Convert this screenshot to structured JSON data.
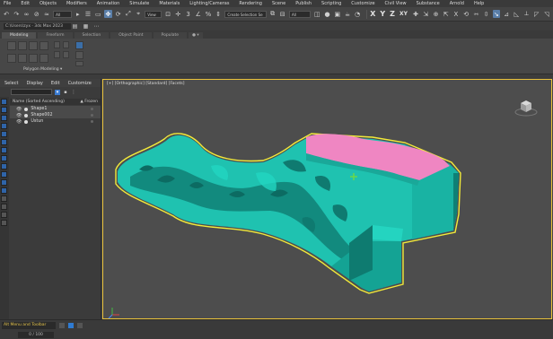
{
  "menubar": [
    "File",
    "Edit",
    "Objects",
    "Modifiers",
    "Animation",
    "Simulate",
    "Materials",
    "Lighting/Cameras",
    "Rendering",
    "Scene",
    "Publish",
    "Scripting",
    "Customize",
    "Civil View",
    "Substance",
    "Arnold",
    "Help"
  ],
  "toolbar": {
    "view_select": "View",
    "selection_set": "Create Selection Se",
    "filter": "All",
    "axes": [
      "X",
      "Y",
      "Z",
      "XY"
    ]
  },
  "project": {
    "path": "C:\\Users\\zyx · 3ds Max 2023"
  },
  "ribbon": {
    "tabs": [
      "Modeling",
      "Freeform",
      "Selection",
      "Object Paint",
      "Populate"
    ],
    "panel_label": "Polygon Modeling ▾"
  },
  "scene_explorer": {
    "menu": [
      "Select",
      "Display",
      "Edit",
      "Customize"
    ],
    "column_name": "Name (Sorted Ascending)",
    "column_frozen": "▲ Frozen",
    "items": [
      {
        "name": "Shape1"
      },
      {
        "name": "Shape002"
      },
      {
        "name": "Ustun"
      }
    ]
  },
  "viewport": {
    "label": "[+] [Orthographic] [Standard] [Facets]",
    "colors": {
      "model": "#1fc2b0",
      "model_dark": "#127d72",
      "cut": "#ef86c2",
      "select_outline": "#f2ea3a",
      "gizmo": "#6ad84a"
    }
  },
  "status": {
    "maxscript": "Alt Menu and Toolbar",
    "counter": "0 / 100"
  }
}
